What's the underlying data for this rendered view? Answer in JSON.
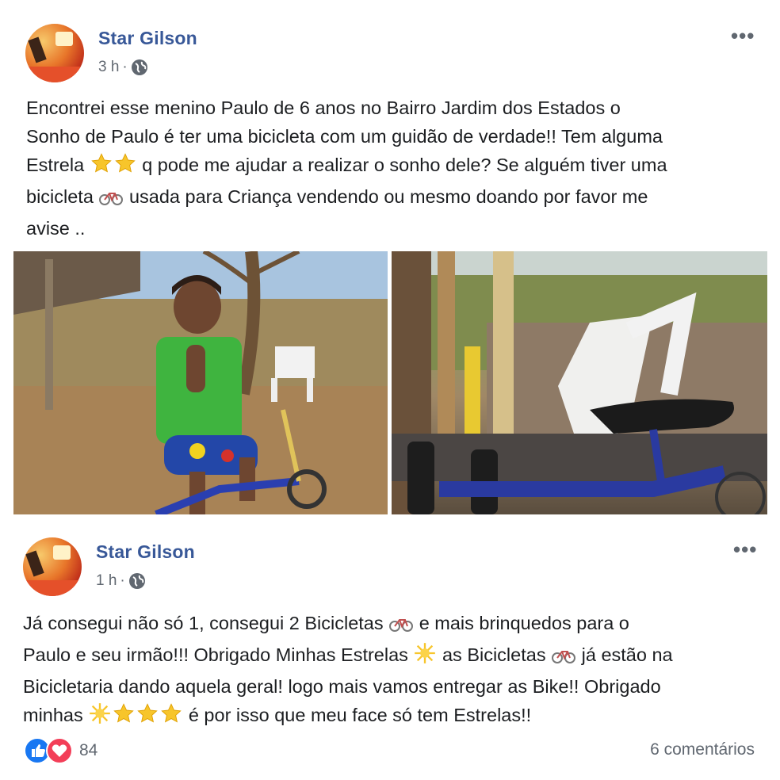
{
  "post1": {
    "author": "Star Gilson",
    "time": "3 h",
    "separator": "·",
    "text_lines": [
      "Encontrei esse menino Paulo de 6 anos no Bairro Jardim dos Estados o",
      "Sonho de Paulo é ter uma bicicleta com um guidão de verdade!! Tem alguma",
      "Estrela",
      "q pode me ajudar a realizar o sonho dele? Se alguém tiver uma",
      "bicicleta",
      "usada para Criança vendendo ou mesmo doando por favor me",
      "avise .."
    ],
    "more": "•••"
  },
  "post2": {
    "author": "Star Gilson",
    "time": "1 h",
    "separator": "·",
    "text_lines": [
      "Já consegui não só 1, consegui 2 Bicicletas",
      "e mais brinquedos para o",
      "Paulo e seu irmão!!! Obrigado Minhas Estrelas",
      "as Bicicletas",
      "já estão na",
      "Bicicletaria dando aquela geral! logo mais vamos entregar as Bike!! Obrigado",
      "minhas",
      "é por isso que meu face só tem Estrelas!!"
    ],
    "more": "•••"
  },
  "footer": {
    "reaction_count": "84",
    "comments": "6 comentários"
  },
  "icons": {
    "globe": "globe-icon",
    "star": "star-emoji",
    "bicycle": "bicycle-emoji",
    "sparkle": "glowing-star-emoji",
    "like": "like-reaction-icon",
    "love": "love-reaction-icon"
  },
  "colors": {
    "author": "#385898",
    "meta": "#606770",
    "text": "#1c1e21",
    "like": "#1877f2",
    "love": "#f33e58",
    "star": "#f7c52b"
  }
}
